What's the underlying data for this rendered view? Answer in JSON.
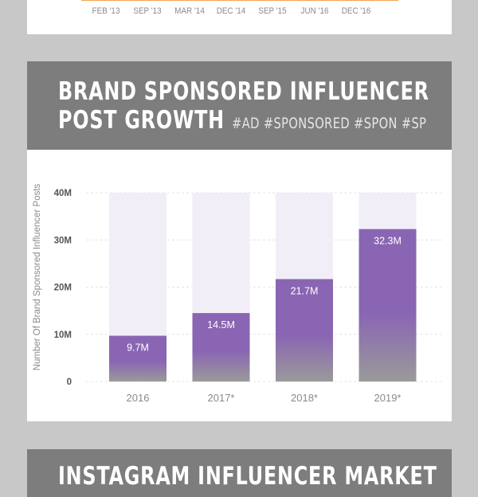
{
  "top_chart": {
    "tick_labels": [
      "FEB '13",
      "SEP '13",
      "MAR '14",
      "DEC '14",
      "SEP '15",
      "JUN '16",
      "DEC '16"
    ],
    "line_color": "#f1a25a"
  },
  "header": {
    "title_line1": "BRAND SPONSORED INFLUENCER",
    "title_line2": "POST GROWTH",
    "hashtags": "#AD #SPONSORED #SPON #SP"
  },
  "chart_data": {
    "type": "bar",
    "categories": [
      "2016",
      "2017*",
      "2018*",
      "2019*"
    ],
    "values": [
      9.7,
      14.5,
      21.7,
      32.3
    ],
    "data_labels": [
      "9.7M",
      "14.5M",
      "21.7M",
      "32.3M"
    ],
    "ylabel": "Number Of Brand Sponsored Influencer Posts",
    "yticks": [
      "0",
      "10M",
      "20M",
      "30M",
      "40M"
    ],
    "ytick_values": [
      0,
      10,
      20,
      30,
      40
    ],
    "ylim": [
      0,
      40
    ],
    "grid": true,
    "colors": {
      "bar": "#8a65b3",
      "bar_bottom": "#9a9a9a",
      "track": "#f2eef7"
    }
  },
  "next_section": {
    "title": "INSTAGRAM INFLUENCER MARKET"
  }
}
